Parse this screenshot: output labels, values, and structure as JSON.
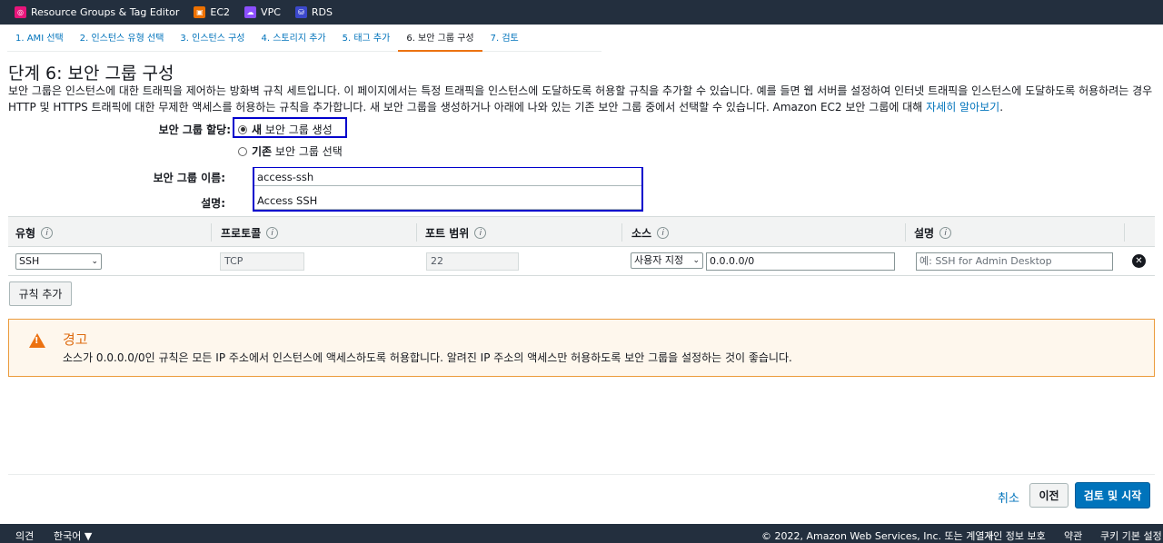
{
  "favorites": [
    {
      "label": "Resource Groups & Tag Editor",
      "icon": "resource-groups-icon",
      "color": "#e7157b"
    },
    {
      "label": "EC2",
      "icon": "ec2-icon",
      "color": "#ed7100"
    },
    {
      "label": "VPC",
      "icon": "vpc-icon",
      "color": "#8c4fff"
    },
    {
      "label": "RDS",
      "icon": "rds-icon",
      "color": "#3b48cc"
    }
  ],
  "steps": [
    "1. AMI 선택",
    "2. 인스턴스 유형 선택",
    "3. 인스턴스 구성",
    "4. 스토리지 추가",
    "5. 태그 추가",
    "6. 보안 그룹 구성",
    "7. 검토"
  ],
  "page": {
    "title": "단계 6: 보안 그룹 구성",
    "description": "보안 그룹은 인스턴스에 대한 트래픽을 제어하는 방화벽 규칙 세트입니다. 이 페이지에서는 특정 트래픽을 인스턴스에 도달하도록 허용할 규칙을 추가할 수 있습니다. 예를 들면 웹 서버를 설정하여 인터넷 트래픽을 인스턴스에 도달하도록 허용하려는 경우 HTTP 및 HTTPS 트래픽에 대한 무제한 액세스를 허용하는 규칙을 추가합니다. 새 보안 그룹을 생성하거나 아래에 나와 있는 기존 보안 그룹 중에서 선택할 수 있습니다. Amazon EC2 보안 그룹에 대해 ",
    "learn_more": "자세히 알아보기",
    "period": "."
  },
  "assign": {
    "label": "보안 그룹 할당:",
    "option_new_bold": "새",
    "option_new_rest": "보안 그룹 생성",
    "option_existing_bold": "기존",
    "option_existing_rest": "보안 그룹 선택",
    "selected": "new"
  },
  "form": {
    "name_label": "보안 그룹 이름:",
    "name_value": "access-ssh",
    "desc_label": "설명:",
    "desc_value": "Access SSH"
  },
  "table": {
    "headers": [
      "유형",
      "프로토콜",
      "포트 범위",
      "소스",
      "설명"
    ],
    "info_glyph": "i",
    "row": {
      "type": "SSH",
      "protocol": "TCP",
      "port": "22",
      "source_type": "사용자 지정",
      "source_value": "0.0.0.0/0",
      "desc_placeholder": "예: SSH for Admin Desktop"
    }
  },
  "add_rule_label": "규칙 추가",
  "warning": {
    "title": "경고",
    "text": "소스가 0.0.0.0/0인 규칙은 모든 IP 주소에서 인스턴스에 액세스하도록 허용합니다. 알려진 IP 주소의 액세스만 허용하도록 보안 그룹을 설정하는 것이 좋습니다."
  },
  "actions": {
    "cancel": "취소",
    "previous": "이전",
    "review_launch": "검토 및 시작"
  },
  "footer": {
    "feedback": "의견",
    "language": "한국어 ▼",
    "copyright": "© 2022, Amazon Web Services, Inc. 또는 계열사.",
    "privacy": "개인 정보 보호",
    "terms": "약관",
    "cookies": "쿠키 기본 설정"
  }
}
